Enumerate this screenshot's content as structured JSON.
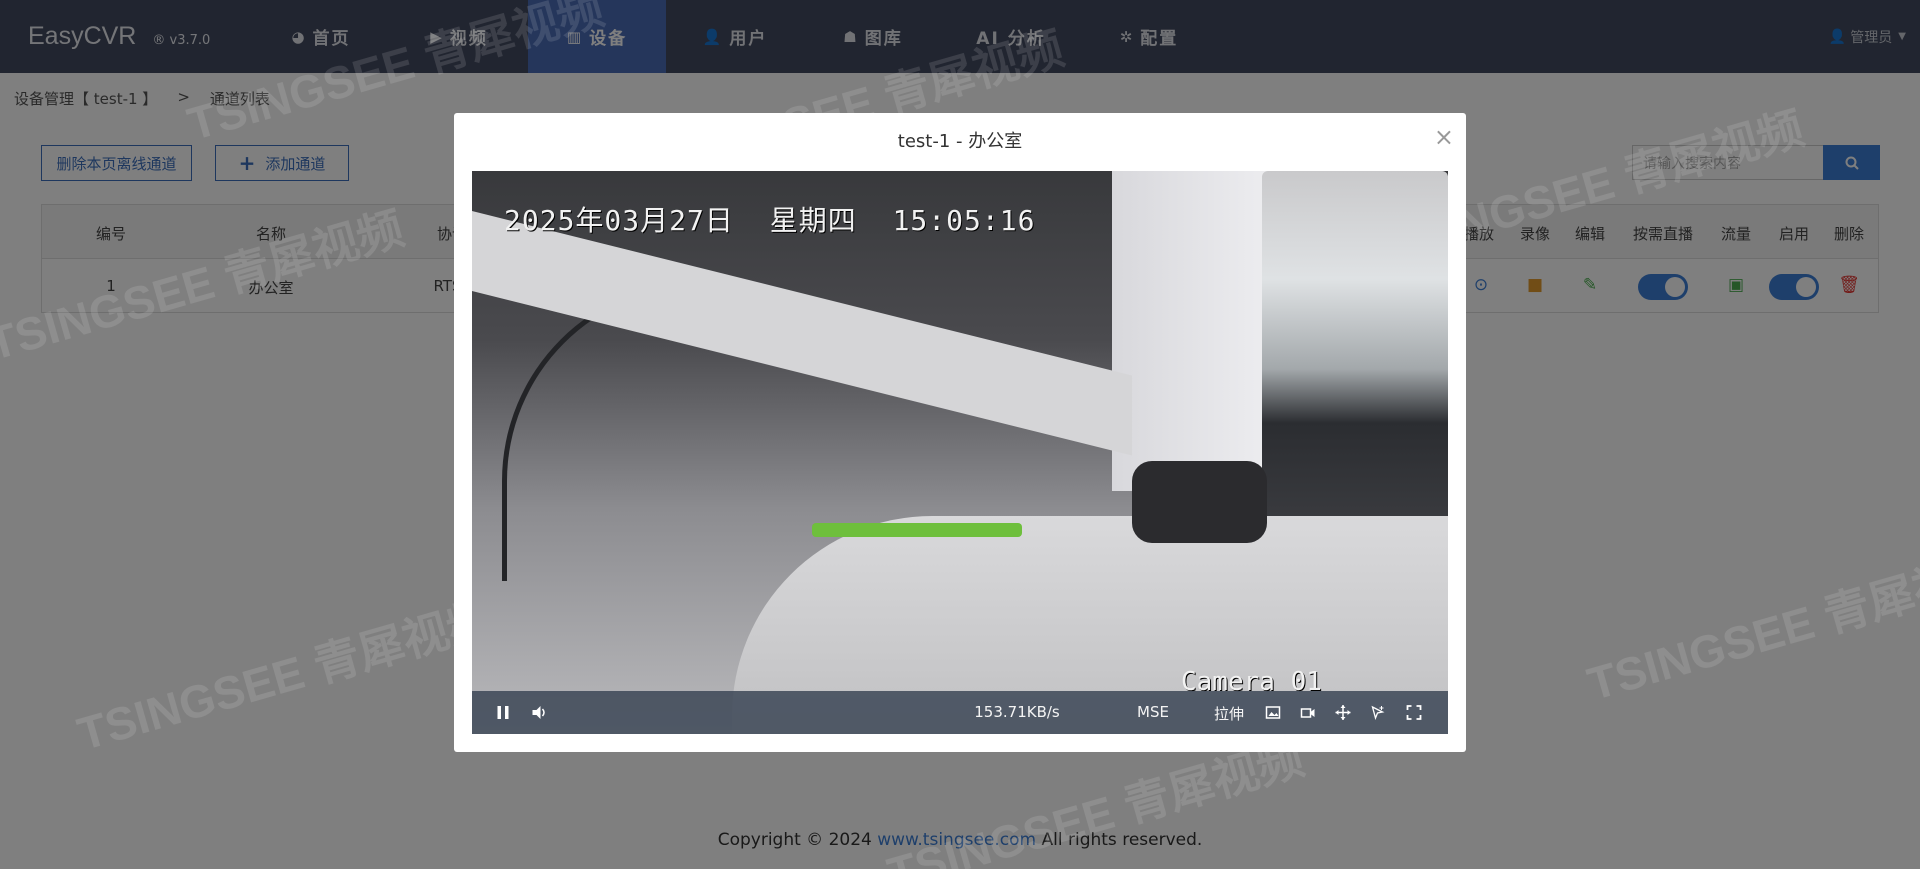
{
  "brand": {
    "name": "EasyCVR",
    "version": "® v3.7.0"
  },
  "nav": [
    {
      "icon": "◕",
      "label": "首页"
    },
    {
      "icon": "▶",
      "label": "视频"
    },
    {
      "icon": "▥",
      "label": "设备"
    },
    {
      "icon": "👤",
      "label": "用户"
    },
    {
      "icon": "☗",
      "label": "图库"
    },
    {
      "icon": "",
      "label": "AI 分析"
    },
    {
      "icon": "✲",
      "label": "配置"
    }
  ],
  "user": {
    "name": "管理员"
  },
  "breadcrumb": {
    "root": "设备管理【 test-1 】",
    "sep": ">",
    "current": "通道列表"
  },
  "toolbar": {
    "delete_offline": "删除本页离线通道",
    "add_channel": "添加通道",
    "search_placeholder": "请输入搜索内容"
  },
  "table": {
    "headers": {
      "id": "编号",
      "name": "名称",
      "protocol": "协议",
      "playback": "播放",
      "record": "录像",
      "edit": "编辑",
      "on_demand": "按需直播",
      "traffic": "流量",
      "enable": "启用",
      "delete": "删除"
    },
    "rows": [
      {
        "id": "1",
        "name": "办公室",
        "protocol": "RTSP"
      }
    ]
  },
  "footer": {
    "prefix": "Copyright © 2024 ",
    "link": "www.tsingsee.com",
    "suffix": " All rights reserved."
  },
  "watermark": "TSINGSEE 青犀视频",
  "modal": {
    "title": "test-1 - 办公室",
    "close": "×",
    "osd_time": "2025年03月27日 星期四 15:05:16",
    "osd_camera": "Camera 01",
    "controls": {
      "bitrate": "153.71KB/s",
      "mode": "MSE",
      "stretch": "拉伸"
    }
  },
  "colors": {
    "nav_bg": "#434b60",
    "nav_active": "#4a6cb7",
    "accent": "#3d7fd6"
  }
}
